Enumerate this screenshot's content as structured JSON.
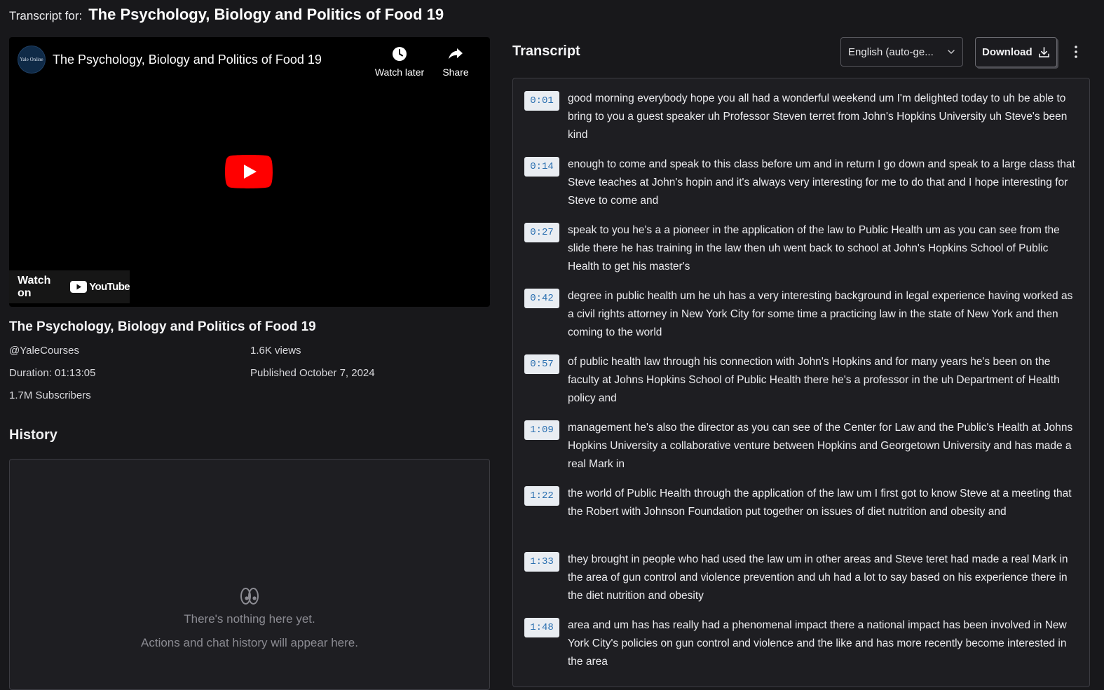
{
  "header": {
    "label": "Transcript for:",
    "title": "The Psychology, Biology and Politics of Food 19"
  },
  "video": {
    "channel_avatar_text": "Yale Online",
    "title": "The Psychology, Biology and Politics of Food 19",
    "watch_later_label": "Watch later",
    "share_label": "Share",
    "watch_on_label": "Watch on",
    "youtube_label": "YouTube"
  },
  "info": {
    "title": "The Psychology, Biology and Politics of Food 19",
    "channel": "@YaleCourses",
    "views": "1.6K views",
    "duration": "Duration: 01:13:05",
    "published": "Published October 7, 2024",
    "subscribers": "1.7M Subscribers"
  },
  "history": {
    "heading": "History",
    "empty_title": "There's nothing here yet.",
    "empty_subtitle": "Actions and chat history will appear here."
  },
  "transcript": {
    "heading": "Transcript",
    "language_selected": "English (auto-ge...",
    "download_label": "Download",
    "segments": [
      {
        "time": "0:01",
        "text": "good morning everybody hope you all had a wonderful weekend um I'm delighted today to uh be able to bring to you a guest speaker uh Professor Steven terret from John's Hopkins University uh Steve's been kind"
      },
      {
        "time": "0:14",
        "text": "enough to come and speak to this class before um and in return I go down and speak to a large class that Steve teaches at John's hopin and it's always very interesting for me to do that and I hope interesting for Steve to come and"
      },
      {
        "time": "0:27",
        "text": "speak to you he's a a pioneer in the application of the law to Public Health um as you can see from the slide there he has training in the law then uh went back to school at John's Hopkins School of Public Health to get his master's"
      },
      {
        "time": "0:42",
        "text": "degree in public health um he uh has a very interesting background in legal experience having worked as a civil rights attorney in New York City for some time a practicing law in the state of New York and then coming to the world"
      },
      {
        "time": "0:57",
        "text": "of public health law through his connection with John's Hopkins and for many years he's been on the faculty at Johns Hopkins School of Public Health there he's a professor in the uh Department of Health policy and"
      },
      {
        "time": "1:09",
        "text": "management he's also the director as you can see of the Center for Law and the Public's Health at Johns Hopkins University a collaborative venture between Hopkins and Georgetown University and has made a real Mark in"
      },
      {
        "time": "1:22",
        "text": "the world of Public Health through the application of the law um I first got to know Steve at a meeting that the Robert with Johnson Foundation put together on issues of diet nutrition and obesity and"
      },
      {
        "time": "1:33",
        "text": "they brought in people who had used the law um in other areas and Steve teret had made a real Mark in the area of gun control and violence prevention and uh had a lot to say based on his experience there in the diet nutrition and obesity"
      },
      {
        "time": "1:48",
        "text": "area and um has has really had a phenomenal impact there a national impact has been involved in New York City's policies on gun control and violence and the like and has more recently become interested in the area"
      }
    ]
  },
  "colors": {
    "background": "#18181b",
    "panel": "#1e1e22",
    "timestamp_bg": "#e9edf2",
    "timestamp_text": "#2a6fb0",
    "play_red": "#ff0000"
  }
}
